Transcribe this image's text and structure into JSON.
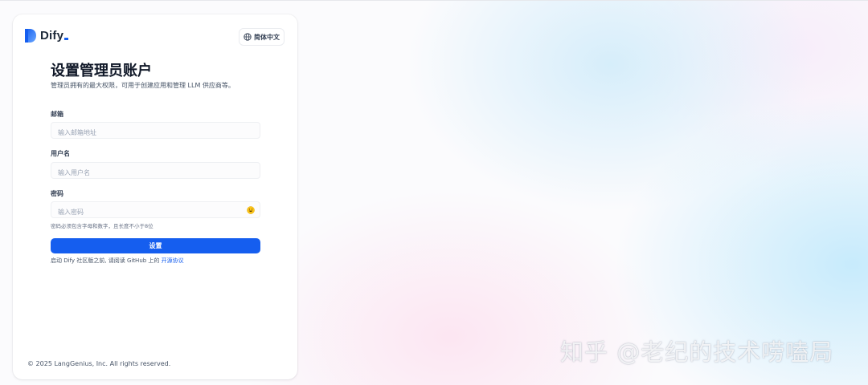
{
  "brand": {
    "name": "Dify",
    "accent": "#155eef"
  },
  "language": {
    "label": "简体中文",
    "icon": "globe-icon"
  },
  "setup": {
    "title": "设置管理员账户",
    "subtitle": "管理员拥有的最大权限，可用于创建应用和管理 LLM 供应商等。",
    "email": {
      "label": "邮箱",
      "placeholder": "输入邮箱地址",
      "value": ""
    },
    "username": {
      "label": "用户名",
      "placeholder": "输入用户名",
      "value": ""
    },
    "password": {
      "label": "密码",
      "placeholder": "输入密码",
      "value": "",
      "toggle_icon": "emoji-toggle-icon",
      "hint": "密码必须包含字母和数字，且长度不小于8位"
    },
    "submit_label": "设置",
    "terms_prefix": "启动 Dify 社区版之前, 请阅读 GitHub 上的 ",
    "terms_link": "开源协议"
  },
  "footer": {
    "copyright": "© 2025 LangGenius, Inc. All rights reserved."
  },
  "watermark": {
    "text": "知乎 @老纪的技术唠嗑局"
  }
}
